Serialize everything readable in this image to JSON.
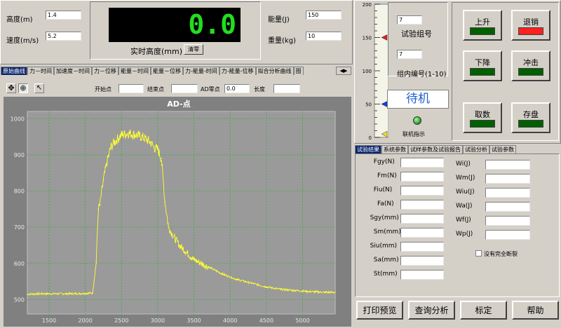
{
  "params": {
    "height_label": "高度(m)",
    "height_value": "1.4",
    "speed_label": "速度(m/s)",
    "speed_value": "5.2",
    "energy_label": "能量(J)",
    "energy_value": "150",
    "weight_label": "重量(kg)",
    "weight_value": "10"
  },
  "display": {
    "value": "0.0",
    "label": "实时高度(mm)",
    "clear_label": "清零",
    "value_color": "#22dd22"
  },
  "gauge": {
    "ticks": [
      "200",
      "150",
      "100",
      "50",
      "0"
    ],
    "level_red": 150,
    "level_blue": 50,
    "level_yellow": 5
  },
  "test": {
    "group_value": "7",
    "group_label": "试验组号",
    "inner_value": "7",
    "inner_label": "组内编号(1-10)",
    "status": "待机",
    "online_label": "联机指示"
  },
  "control_buttons": [
    {
      "label": "上升",
      "led": "#006000"
    },
    {
      "label": "退销",
      "led": "#ff2020"
    },
    {
      "label": "下降",
      "led": "#006000"
    },
    {
      "label": "冲击",
      "led": "#006000"
    },
    {
      "label": "取数",
      "led": "#006000"
    },
    {
      "label": "存盘",
      "led": "#006000"
    }
  ],
  "plot_tabs": [
    "原始曲线",
    "力－时间",
    "加速度－时间",
    "力－位移",
    "能量－时间",
    "能量－位移",
    "力-能量-时间",
    "力-能量-位移",
    "拟合分析曲线",
    "图"
  ],
  "plot_toolbar": {
    "start_label": "开始点",
    "end_label": "结束点",
    "ad_label": "AD零点",
    "ad_value": "0.0",
    "length_label": "长度"
  },
  "result_tabs": [
    "试验结果",
    "系统参数",
    "试样参数及试验报告",
    "试验分析",
    "试验参数"
  ],
  "results_left": [
    "Fgy(N)",
    "Fm(N)",
    "Fiu(N)",
    "Fa(N)",
    "Sgy(mm)",
    "Sm(mm)",
    "Siu(mm)",
    "Sa(mm)",
    "St(mm)"
  ],
  "results_right": [
    "Wi(J)",
    "Wm(J)",
    "Wiu(J)",
    "Wa(J)",
    "Wf(J)",
    "Wp(J)"
  ],
  "checkbox_label": "没有完全断裂",
  "bottom_buttons": [
    "打印预览",
    "查询分析",
    "标定",
    "帮助"
  ],
  "chart_data": {
    "type": "line",
    "title": "AD-点",
    "x_ticks": [
      "1500",
      "2000",
      "2500",
      "3000",
      "3500",
      "4000",
      "4500",
      "5000"
    ],
    "y_ticks": [
      "1000",
      "900",
      "800",
      "700",
      "600",
      "500"
    ],
    "xlim": [
      1200,
      5450
    ],
    "ylim": [
      460,
      1020
    ],
    "grid": true,
    "line_color": "#ffff33",
    "background": "#9a9a9a",
    "x": [
      1200,
      1400,
      1600,
      1800,
      2000,
      2100,
      2150,
      2180,
      2200,
      2250,
      2300,
      2350,
      2400,
      2450,
      2500,
      2600,
      2700,
      2800,
      2900,
      2950,
      3000,
      3050,
      3100,
      3150,
      3200,
      3300,
      3400,
      3500,
      3700,
      3900,
      4100,
      4300,
      4500,
      4700,
      4900,
      5100,
      5300,
      5450
    ],
    "y": [
      515,
      516,
      516,
      516,
      517,
      518,
      600,
      750,
      760,
      830,
      880,
      920,
      935,
      945,
      955,
      960,
      955,
      948,
      935,
      920,
      915,
      890,
      770,
      700,
      680,
      650,
      630,
      610,
      590,
      570,
      555,
      545,
      535,
      528,
      525,
      522,
      520,
      520
    ]
  }
}
